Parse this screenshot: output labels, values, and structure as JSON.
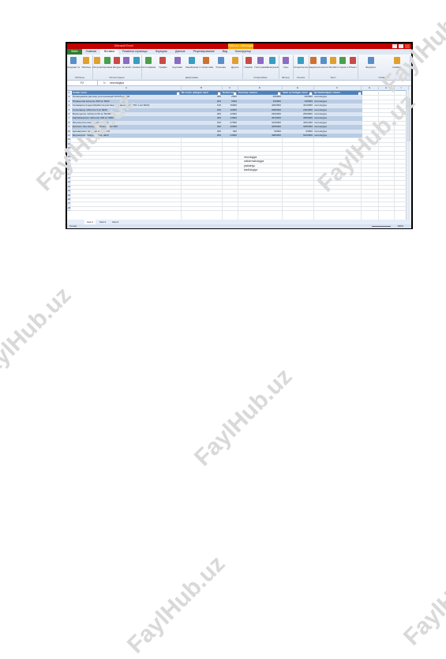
{
  "window": {
    "title": "Microsoft Excel",
    "context_tab": "Работа с таблицами"
  },
  "ribbon": {
    "tabs": [
      "Файл",
      "Главная",
      "Вставка",
      "Разметка страницы",
      "Формулы",
      "Данные",
      "Рецензирование",
      "Вид",
      "Конструктор"
    ],
    "active_tab": "Вставка",
    "groups": [
      {
        "label": "Таблицы",
        "buttons": [
          "Сводная таблица",
          "Таблица"
        ]
      },
      {
        "label": "Иллюстрации",
        "buttons": [
          "Рисунок",
          "Картинка",
          "Фигуры",
          "SmartArt",
          "Снимок"
        ]
      },
      {
        "label": "Диаграммы",
        "buttons": [
          "Гистограмма",
          "График",
          "Круговая",
          "Линейчатая",
          "С областями",
          "Точечная",
          "Другие"
        ]
      },
      {
        "label": "Спарклайны",
        "buttons": [
          "График",
          "Гистограмма",
          "Выигрыш/проигрыш"
        ]
      },
      {
        "label": "Фильтр",
        "buttons": [
          "Срез"
        ]
      },
      {
        "label": "Ссылки",
        "buttons": [
          "Гиперссылка"
        ]
      },
      {
        "label": "Текст",
        "buttons": [
          "Надпись",
          "Колонтитулы",
          "WordArt",
          "Строка подписи",
          "Объект"
        ]
      },
      {
        "label": "Символы",
        "buttons": [
          "Формула",
          "Символ"
        ]
      }
    ]
  },
  "formula_bar": {
    "name_box": "F2",
    "fx": "fx",
    "value": "nevrologiya"
  },
  "columns": [
    "A",
    "B",
    "C",
    "D",
    "E",
    "F",
    "G",
    "H",
    "I"
  ],
  "table": {
    "headers": [
      "Inotlar nomi",
      "Bir ta'yin qilingan narxi",
      "Sotish miqdori",
      "Umumiy summa",
      "Jami qo'shilgan narxi",
      "Qo'llaniladigan sohasi"
    ],
    "rows": [
      [
        "Проводников раствор для инъекций 10%/5 мл №5",
        "300",
        "2500",
        "250000",
        "262500",
        "nevrologiya"
      ],
      [
        "Пирацетам капсулы 200 мг №30",
        "200",
        "5300",
        "106000",
        "346900",
        "nevrologiya"
      ],
      [
        "Гепамерин (гидрообработка раствор для инъекций 2,5% 1 мл №10)",
        "120",
        "15000",
        "4200000",
        "4410000",
        "nevrologiya"
      ],
      [
        "Сульпирид таблетки 3 мг №30",
        "180",
        "12000",
        "2080000",
        "2184000",
        "nevrologiya"
      ],
      [
        "Винпоцетин таблетки 50 мг №100",
        "200",
        "12000",
        "2400000",
        "2520000",
        "nevrologiya"
      ],
      [
        "Карбамазепин таблетки 200 мг №50",
        "360",
        "13000",
        "4610000",
        "3050000",
        "nevrologiya"
      ],
      [
        "Флуоксетин капсулы 20 мг №20",
        "150",
        "27500",
        "4125000",
        "4331250",
        "nevrologiya"
      ],
      [
        "Цитикол пин капсулы 300 мг/2,5 мл №5",
        "300",
        "10000",
        "3000000",
        "3250000",
        "nevrologiya"
      ],
      [
        "Циннаризин таблетки 25 мг №50",
        "200",
        "400",
        "90000",
        "94500",
        "nevrologiya"
      ],
      [
        "Флуоксетин капсулы 20 мг №10",
        "200",
        "24900",
        "4980000",
        "5229000",
        "nevrologiya"
      ]
    ]
  },
  "row_numbers": [
    "1",
    "2",
    "3",
    "4",
    "5",
    "6",
    "7",
    "8",
    "9",
    "10",
    "11",
    "12",
    "13",
    "14",
    "15",
    "16",
    "17",
    "18",
    "19",
    "20",
    "21",
    "22",
    "23",
    "24",
    "25",
    "26",
    "27",
    "28"
  ],
  "list_values": [
    "nevrologiya",
    "antidermatologiya",
    "pediatriya",
    "kardiologiya"
  ],
  "sheet_tabs": [
    "Лист1",
    "Лист2",
    "Лист3"
  ],
  "active_sheet": "Лист1",
  "status": {
    "ready": "Готово",
    "zoom": "100%"
  },
  "watermark": "FaylHub.uz"
}
